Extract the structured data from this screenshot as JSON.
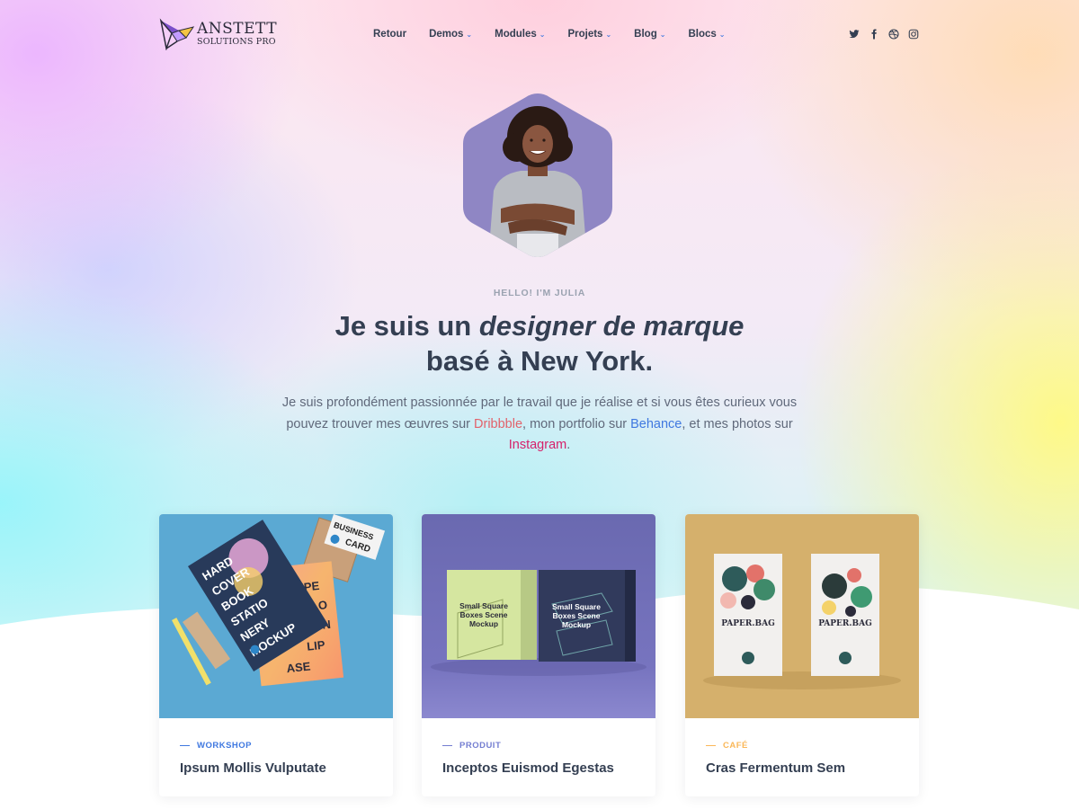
{
  "brand": {
    "name": "ANSTETT",
    "tagline": "SOLUTIONS PRO"
  },
  "nav": [
    {
      "label": "Retour",
      "dropdown": false
    },
    {
      "label": "Demos",
      "dropdown": true
    },
    {
      "label": "Modules",
      "dropdown": true
    },
    {
      "label": "Projets",
      "dropdown": true
    },
    {
      "label": "Blog",
      "dropdown": true
    },
    {
      "label": "Blocs",
      "dropdown": true
    }
  ],
  "socials": [
    "twitter-icon",
    "facebook-icon",
    "dribbble-icon",
    "instagram-icon"
  ],
  "hero": {
    "kicker": "HELLO! I'M JULIA",
    "headline_pre": "Je suis un ",
    "headline_em": "designer de marque",
    "headline_post": "basé à New York.",
    "lead_1": "Je suis profondément passionnée par le travail que je réalise et si vous êtes curieux vous pouvez trouver mes œuvres sur ",
    "link_dribbble": "Dribbble",
    "lead_2": ", mon portfolio sur ",
    "link_behance": "Behance",
    "lead_3": ", et mes photos sur ",
    "link_instagram": "Instagram",
    "lead_4": "."
  },
  "cards": [
    {
      "category": "WORKSHOP",
      "title": "Ipsum Mollis Vulputate",
      "accent": "#3f78e0"
    },
    {
      "category": "PRODUIT",
      "title": "Inceptos Euismod Egestas",
      "accent": "#747ed1"
    },
    {
      "category": "CAFÉ",
      "title": "Cras Fermentum Sem",
      "accent": "#fab758"
    }
  ],
  "mockup_text": {
    "stationery": [
      "HARD",
      "COVER",
      "BOOK",
      "STATIO",
      "NERY",
      "MOCKUP"
    ],
    "stationery_side": [
      "IPE",
      "CLO",
      "DGN",
      "LIP",
      "ASE"
    ],
    "business_card": [
      "BUSINESS",
      "CARD"
    ],
    "boxes": [
      "Small Square",
      "Boxes Scene",
      "Mockup"
    ],
    "bag": "PAPER.BAG"
  },
  "colors": {
    "heading": "#343f52",
    "muted": "#9ba3b1",
    "body": "#60697b",
    "link_dribbble": "#e2626b",
    "link_behance": "#3f78e0",
    "link_instagram": "#d6216b",
    "chevron": "#3f78e0"
  }
}
